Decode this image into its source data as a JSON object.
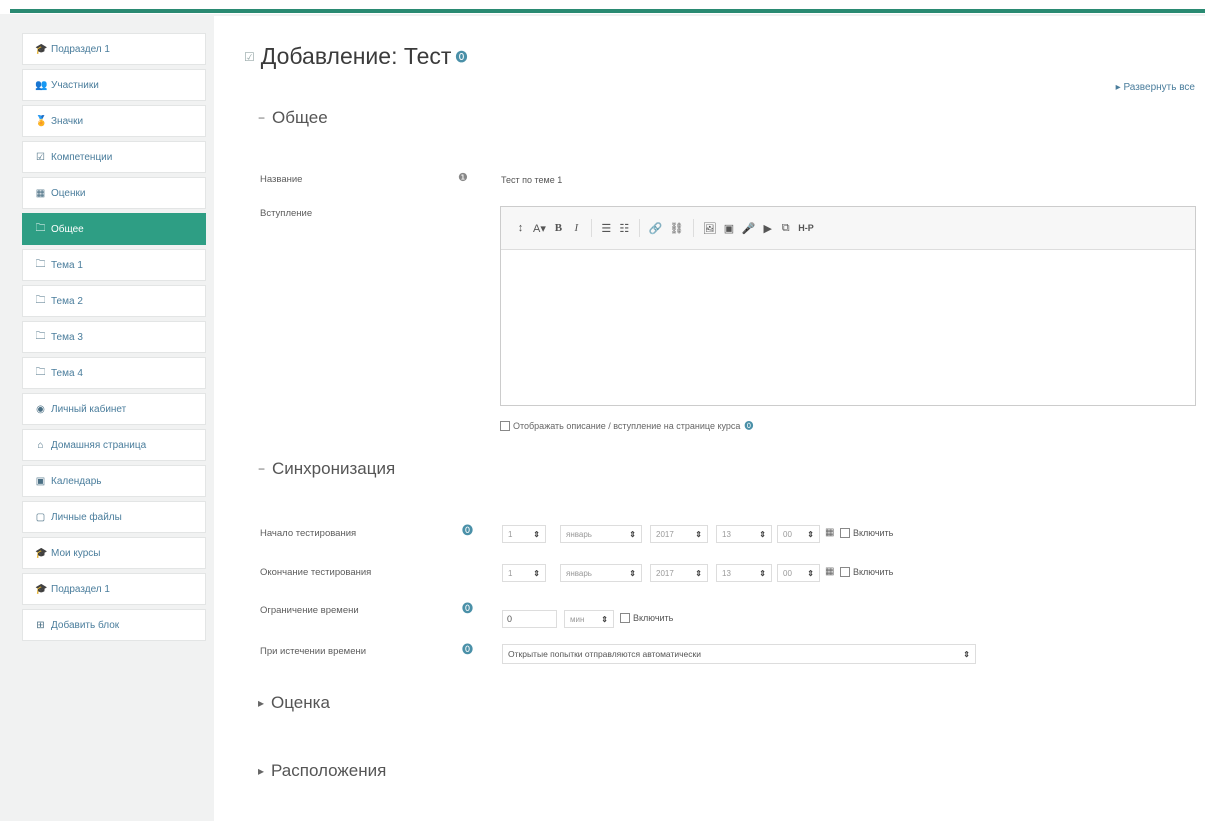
{
  "sidebar": {
    "items": [
      {
        "label": "Подраздел 1",
        "icon": "graduation-cap-icon",
        "glyph": "🎓"
      },
      {
        "label": "Участники",
        "icon": "users-icon",
        "glyph": "👥"
      },
      {
        "label": "Значки",
        "icon": "badge-icon",
        "glyph": "🏅"
      },
      {
        "label": "Компетенции",
        "icon": "checklist-icon",
        "glyph": "☑"
      },
      {
        "label": "Оценки",
        "icon": "table-icon",
        "glyph": "▦"
      },
      {
        "label": "Общее",
        "icon": "folder-icon",
        "glyph": "🗀",
        "active": true
      },
      {
        "label": "Тема 1",
        "icon": "folder-icon",
        "glyph": "🗀"
      },
      {
        "label": "Тема 2",
        "icon": "folder-icon",
        "glyph": "🗀"
      },
      {
        "label": "Тема 3",
        "icon": "folder-icon",
        "glyph": "🗀"
      },
      {
        "label": "Тема 4",
        "icon": "folder-icon",
        "glyph": "🗀"
      },
      {
        "label": "Личный кабинет",
        "icon": "dashboard-icon",
        "glyph": "◉"
      },
      {
        "label": "Домашняя страница",
        "icon": "home-icon",
        "glyph": "⌂"
      },
      {
        "label": "Календарь",
        "icon": "calendar-icon",
        "glyph": "▣"
      },
      {
        "label": "Личные файлы",
        "icon": "file-icon",
        "glyph": "▢"
      },
      {
        "label": "Мои курсы",
        "icon": "graduation-cap-icon",
        "glyph": "🎓"
      },
      {
        "label": "Подраздел 1",
        "icon": "graduation-cap-icon",
        "glyph": "🎓"
      },
      {
        "label": "Добавить блок",
        "icon": "plus-square-icon",
        "glyph": "⊞"
      }
    ]
  },
  "header": {
    "title": "Добавление: Тест",
    "expand_all": "Развернуть все"
  },
  "sections": {
    "general": "Общее",
    "timing": "Синхронизация",
    "grade": "Оценка",
    "layout": "Расположения"
  },
  "fields": {
    "name_label": "Название",
    "name_value": "Тест по теме 1",
    "intro_label": "Вступление",
    "show_desc": "Отображать описание / вступление на странице курса",
    "open_label": "Начало тестирования",
    "close_label": "Окончание тестирования",
    "limit_label": "Ограничение времени",
    "expire_label": "При истечении времени",
    "enable": "Включить",
    "limit_value": "0",
    "limit_unit": "мин",
    "expire_option": "Открытые попытки отправляются автоматически"
  },
  "date_selects": {
    "day": "1",
    "month": "январь",
    "year": "2017",
    "hour": "13",
    "minute": "00"
  },
  "toolbar": {
    "buttons": [
      "↕",
      "A▾",
      "B",
      "I",
      "☰",
      "☷",
      "🔗",
      "⛓",
      "🖼",
      "▣",
      "🎤",
      "▶",
      "⧉",
      "H-P"
    ]
  }
}
